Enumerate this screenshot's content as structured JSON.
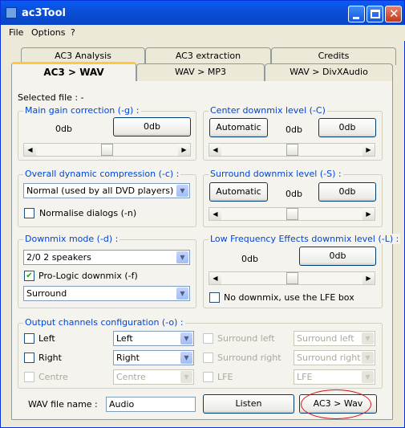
{
  "window": {
    "title": "ac3Tool"
  },
  "menu": [
    "File",
    "Options",
    "?"
  ],
  "tabs_back": [
    "AC3 Analysis",
    "AC3 extraction",
    "Credits"
  ],
  "tabs_front": [
    "AC3 > WAV",
    "WAV > MP3",
    "WAV > DivXAudio"
  ],
  "selected_file": "Selected file : -",
  "main_gain": {
    "label": "Main gain correction (-g) :",
    "value": "0db",
    "button": "0db",
    "level": 0.5
  },
  "center": {
    "label": "Center downmix level (-C)",
    "auto": "Automatic",
    "value": "0db",
    "button": "0db",
    "level": 0.5
  },
  "dynamic": {
    "label": "Overall dynamic compression (-c) :",
    "value": "Normal (used by all DVD players)",
    "normalise": "Normalise dialogs (-n)",
    "normalise_checked": false
  },
  "surround": {
    "label": "Surround downmix level (-S) :",
    "auto": "Automatic",
    "value": "0db",
    "button": "0db",
    "level": 0.5
  },
  "downmix": {
    "label": "Downmix mode (-d) :",
    "mode": "2/0 2 speakers",
    "prologic": "Pro-Logic downmix (-f)",
    "prologic_checked": true,
    "variant": "Surround"
  },
  "lfe": {
    "label": "Low Frequency Effects downmix level (-L) :",
    "value": "0db",
    "button": "0db",
    "level": 0.5,
    "nodownmix": "No downmix, use the LFE box",
    "nodownmix_checked": false
  },
  "channels": {
    "label": "Output channels configuration (-o) :",
    "left": {
      "check": "Left",
      "value": "Left"
    },
    "right": {
      "check": "Right",
      "value": "Right"
    },
    "centre": {
      "check": "Centre",
      "value": "Centre"
    },
    "sleft": {
      "check": "Surround left",
      "value": "Surround left"
    },
    "sright": {
      "check": "Surround right",
      "value": "Surround right"
    },
    "lfe": {
      "check": "LFE",
      "value": "LFE"
    }
  },
  "bottom": {
    "wav_label": "WAV file name :",
    "wav_value": "Audio",
    "listen": "Listen",
    "convert": "AC3 > Wav"
  }
}
